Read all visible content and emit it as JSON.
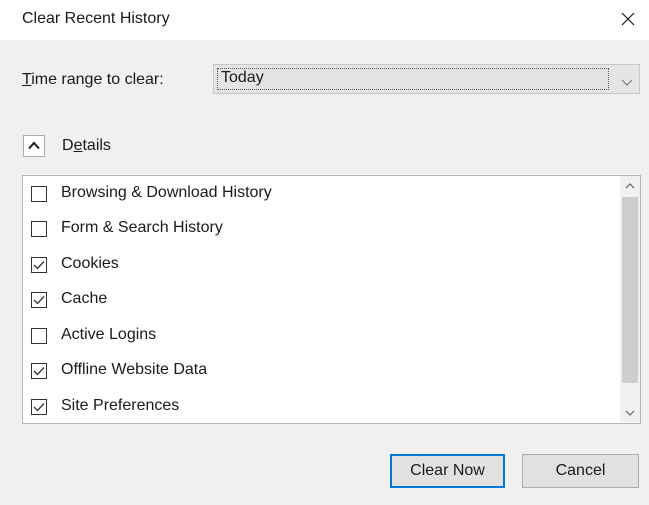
{
  "dialog": {
    "title": "Clear Recent History",
    "close_icon": "close-icon"
  },
  "time_range": {
    "label_accel": "T",
    "label_rest": "ime range to clear:",
    "selected": "Today",
    "dropdown_icon": "chevron-down-icon"
  },
  "details": {
    "toggle_icon": "chevron-up-icon",
    "label_pre": "D",
    "label_accel": "e",
    "label_rest": "tails"
  },
  "items": [
    {
      "label": "Browsing & Download History",
      "checked": false
    },
    {
      "label": "Form & Search History",
      "checked": false
    },
    {
      "label": "Cookies",
      "checked": true
    },
    {
      "label": "Cache",
      "checked": true
    },
    {
      "label": "Active Logins",
      "checked": false
    },
    {
      "label": "Offline Website Data",
      "checked": true
    },
    {
      "label": "Site Preferences",
      "checked": true
    }
  ],
  "buttons": {
    "clear_now": "Clear Now",
    "cancel": "Cancel"
  },
  "colors": {
    "accent": "#0078d7",
    "dialog_bg": "#f0f0f0"
  }
}
